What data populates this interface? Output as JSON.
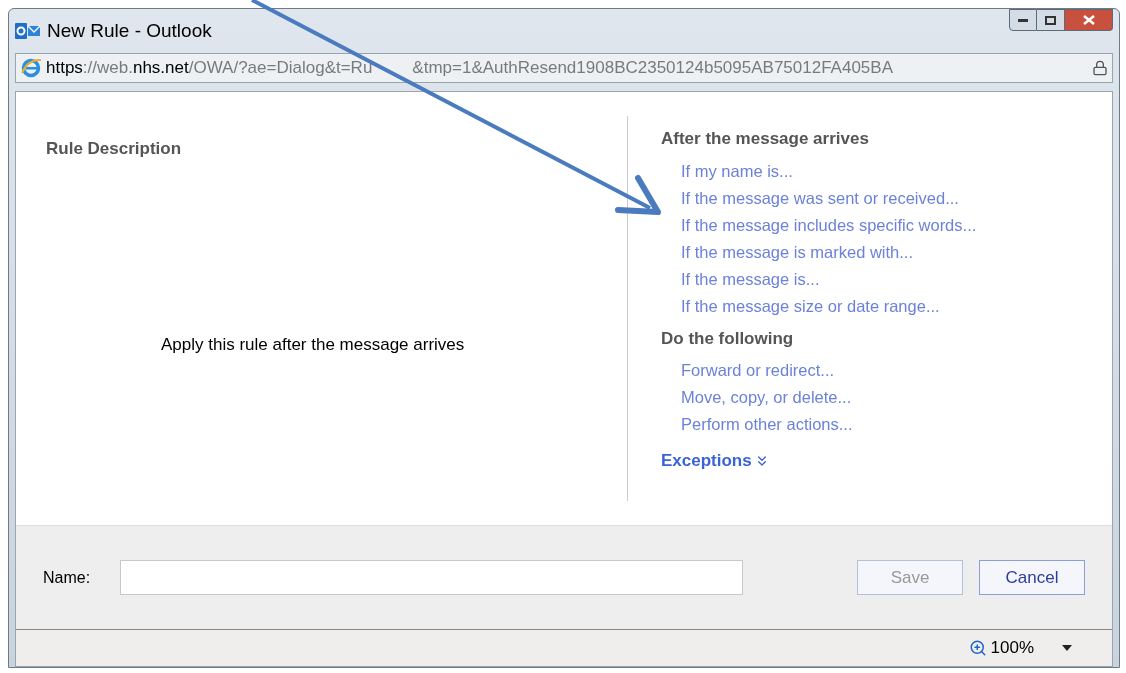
{
  "window": {
    "title": "New Rule - Outlook"
  },
  "address_bar": {
    "url": [
      {
        "text": "https",
        "strong": true
      },
      {
        "text": "://web.",
        "strong": false
      },
      {
        "text": "nhs.net",
        "strong": true
      },
      {
        "text": "/OWA/?ae=Dialog&t=Ru",
        "strong": false
      },
      {
        "text": "&tmp=1&AuthResend1908BC2350124b5095AB75012FA405BA",
        "strong": false
      }
    ]
  },
  "rule_description": {
    "heading": "Rule Description",
    "text": "Apply this rule after the message arrives"
  },
  "sections": [
    {
      "heading": "After the message arrives",
      "links": [
        "If my name is...",
        "If the message was sent or received...",
        "If the message includes specific words...",
        "If the message is marked with...",
        "If the message is...",
        "If the message size or date range..."
      ]
    },
    {
      "heading": "Do the following",
      "links": [
        "Forward or redirect...",
        "Move, copy, or delete...",
        "Perform other actions..."
      ]
    }
  ],
  "exceptions": {
    "label": "Exceptions",
    "expanded": false
  },
  "name_field": {
    "label": "Name:"
  },
  "buttons": [
    {
      "label": "Save",
      "disabled": true
    },
    {
      "label": "Cancel",
      "disabled": false
    }
  ],
  "status_bar": {
    "zoom": "100%"
  }
}
